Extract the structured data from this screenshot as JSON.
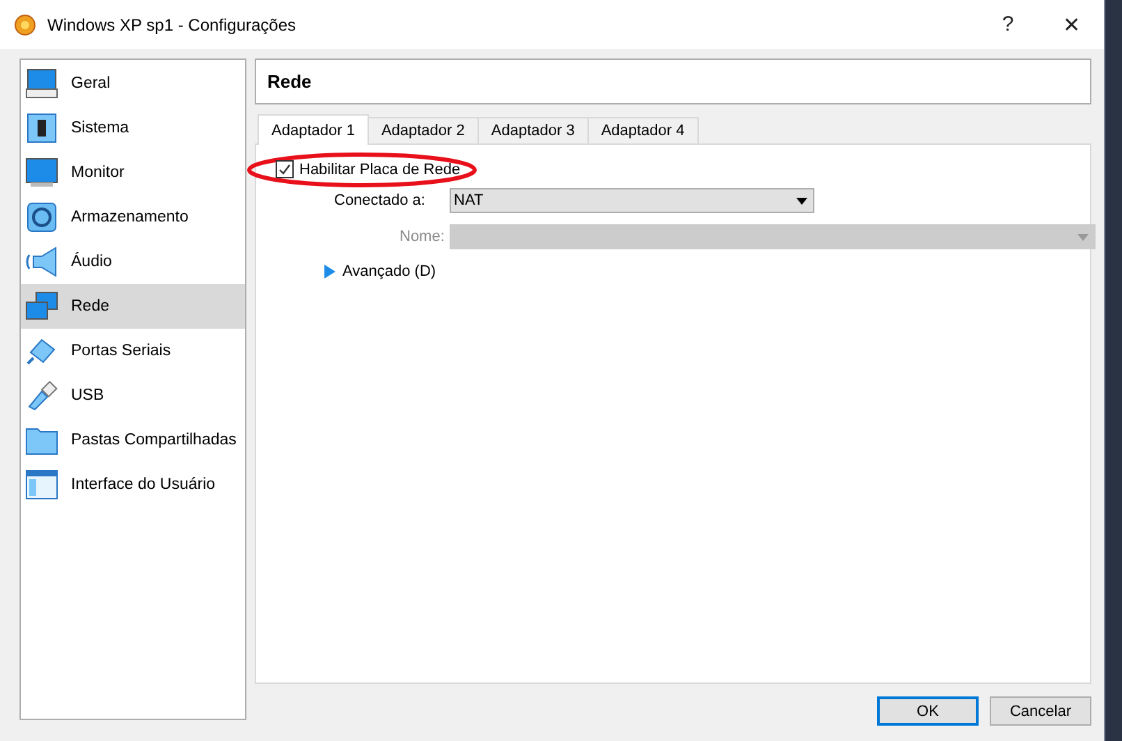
{
  "window": {
    "title": "Windows XP sp1 - Configurações",
    "help": "?",
    "close": "✕"
  },
  "sidebar": {
    "items": [
      {
        "label": "Geral",
        "selected": false
      },
      {
        "label": "Sistema",
        "selected": false
      },
      {
        "label": "Monitor",
        "selected": false
      },
      {
        "label": "Armazenamento",
        "selected": false
      },
      {
        "label": "Áudio",
        "selected": false
      },
      {
        "label": "Rede",
        "selected": true
      },
      {
        "label": "Portas Seriais",
        "selected": false
      },
      {
        "label": "USB",
        "selected": false
      },
      {
        "label": "Pastas Compartilhadas",
        "selected": false
      },
      {
        "label": "Interface do Usuário",
        "selected": false
      }
    ]
  },
  "page": {
    "title": "Rede",
    "tabs": [
      {
        "label": "Adaptador 1",
        "selected": true
      },
      {
        "label": "Adaptador 2",
        "selected": false
      },
      {
        "label": "Adaptador 3",
        "selected": false
      },
      {
        "label": "Adaptador 4",
        "selected": false
      }
    ],
    "enable": {
      "label": "Habilitar Placa de Rede",
      "checked": true,
      "annotated": true
    },
    "attached": {
      "label": "Conectado a:",
      "value": "NAT"
    },
    "name": {
      "label": "Nome:",
      "disabled": true
    },
    "advanced": {
      "label": "Avançado (D)",
      "expanded": false
    }
  },
  "buttons": [
    {
      "label": "OK",
      "selected": true
    },
    {
      "label": "Cancelar",
      "selected": false
    }
  ]
}
